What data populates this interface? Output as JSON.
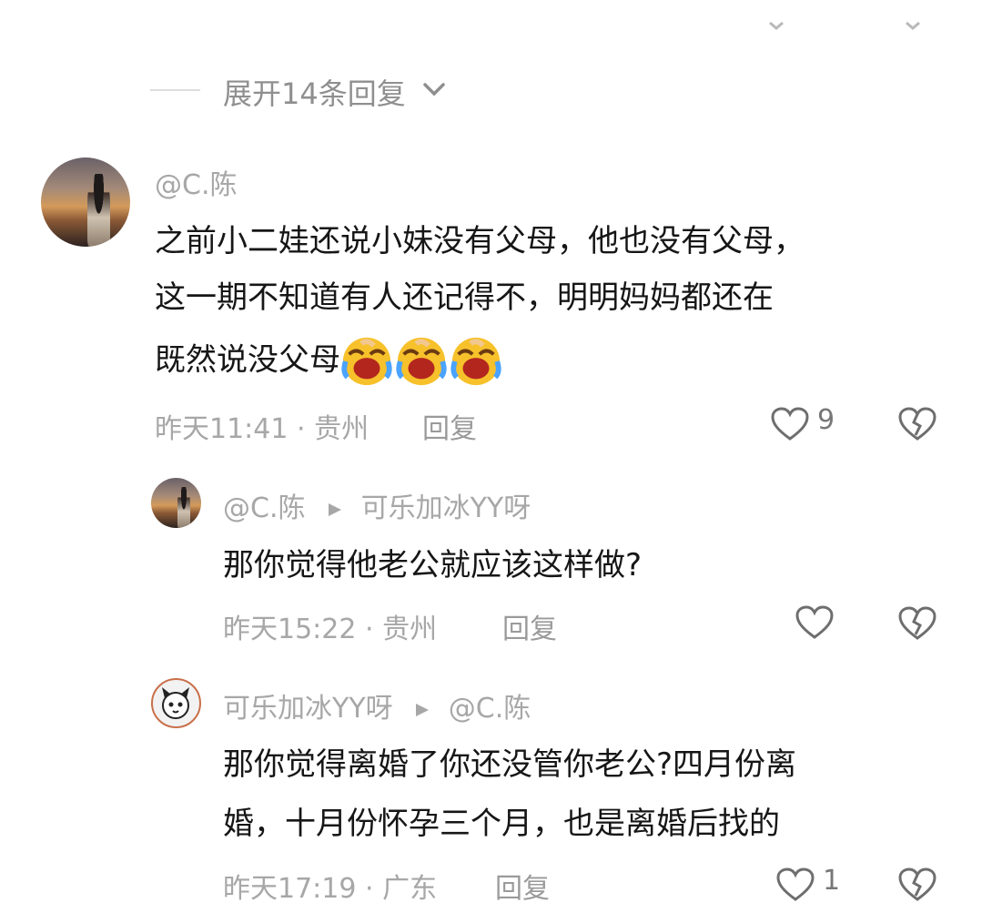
{
  "top": {
    "expand_label": "展开14条回复"
  },
  "comment": {
    "name": "@C.陈",
    "lines": [
      "之前小二娃还说小妹没有父母，他也没有父母，",
      "这一期不知道有人还记得不，明明妈妈都还在",
      "既然说没父母"
    ],
    "emoji_name": "laughing-crying-emoji",
    "time": "昨天11:41",
    "location": "贵州",
    "reply_label": "回复",
    "likes": "9"
  },
  "replies": [
    {
      "from": "@C.陈",
      "to": "可乐加冰YY呀",
      "lines": [
        "那你觉得他老公就应该这样做?"
      ],
      "time": "昨天15:22",
      "location": "贵州",
      "reply_label": "回复",
      "likes": ""
    },
    {
      "from": "可乐加冰YY呀",
      "to": "@C.陈",
      "lines": [
        "那你觉得离婚了你还没管你老公?四月份离",
        "婚，十月份怀孕三个月，也是离婚后找的"
      ],
      "time": "昨天17:19",
      "location": "广东",
      "reply_label": "回复",
      "likes": "1"
    }
  ],
  "icons": {
    "like": "heart-outline-icon",
    "dislike": "broken-heart-icon",
    "expand": "chevron-down-icon",
    "reply_arrow": "play-triangle-icon"
  },
  "colors": {
    "text": "#161616",
    "muted": "#a7a7a7",
    "background": "#ffffff"
  }
}
